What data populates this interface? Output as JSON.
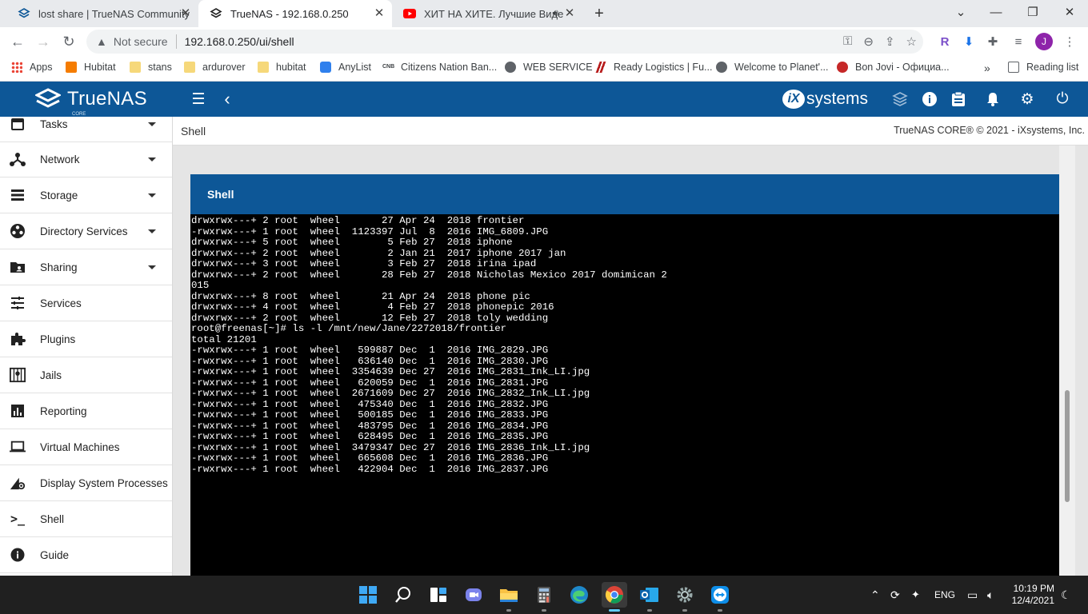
{
  "browser": {
    "tabs": [
      {
        "title": "lost share | TrueNAS Community"
      },
      {
        "title": "TrueNAS - 192.168.0.250"
      },
      {
        "title": "ХИТ НА ХИТЕ. Лучшие Виде"
      }
    ],
    "address": {
      "security": "Not secure",
      "url": "192.168.0.250/ui/shell"
    },
    "profile_initial": "J",
    "bookmarks": [
      "Apps",
      "Hubitat",
      "stans",
      "ardurover",
      "hubitat",
      "AnyList",
      "Citizens Nation Ban...",
      "WEB SERVICE",
      "Ready Logistics | Fu...",
      "Welcome to Planet'...",
      "Bon Jovi - Официа..."
    ],
    "bookmarks_overflow": "»",
    "reading_list": "Reading list"
  },
  "app": {
    "logo_name": "TrueNAS",
    "logo_sub": "CORE",
    "vendor": "systems",
    "vendor_mark": "iX"
  },
  "sidebar": {
    "items": [
      {
        "label": "Tasks",
        "icon": "calendar-icon",
        "dropdown": true
      },
      {
        "label": "Network",
        "icon": "network-icon",
        "dropdown": true
      },
      {
        "label": "Storage",
        "icon": "storage-icon",
        "dropdown": true
      },
      {
        "label": "Directory Services",
        "icon": "directory-icon",
        "dropdown": true
      },
      {
        "label": "Sharing",
        "icon": "folder-share-icon",
        "dropdown": true
      },
      {
        "label": "Services",
        "icon": "tune-icon",
        "dropdown": false
      },
      {
        "label": "Plugins",
        "icon": "puzzle-icon",
        "dropdown": false
      },
      {
        "label": "Jails",
        "icon": "jail-icon",
        "dropdown": false
      },
      {
        "label": "Reporting",
        "icon": "chart-icon",
        "dropdown": false
      },
      {
        "label": "Virtual Machines",
        "icon": "laptop-icon",
        "dropdown": false
      },
      {
        "label": "Display System Processes",
        "icon": "processes-icon",
        "dropdown": false
      },
      {
        "label": "Shell",
        "icon": "terminal-icon",
        "dropdown": false
      },
      {
        "label": "Guide",
        "icon": "info-icon",
        "dropdown": false
      }
    ]
  },
  "page": {
    "title": "Shell",
    "copyright": "TrueNAS CORE® © 2021 - iXsystems, Inc.",
    "card_title": "Shell"
  },
  "terminal": {
    "lines": [
      "drwxrwx---+ 2 root  wheel       27 Apr 24  2018 frontier",
      "-rwxrwx---+ 1 root  wheel  1123397 Jul  8  2016 IMG_6809.JPG",
      "drwxrwx---+ 5 root  wheel        5 Feb 27  2018 iphone",
      "drwxrwx---+ 2 root  wheel        2 Jan 21  2017 iphone 2017 jan",
      "drwxrwx---+ 3 root  wheel        3 Feb 27  2018 irina ipad",
      "drwxrwx---+ 2 root  wheel       28 Feb 27  2018 Nicholas Mexico 2017 domimican 2",
      "015",
      "drwxrwx---+ 8 root  wheel       21 Apr 24  2018 phone pic",
      "drwxrwx---+ 4 root  wheel        4 Feb 27  2018 phonepic 2016",
      "drwxrwx---+ 2 root  wheel       12 Feb 27  2018 toly wedding",
      "root@freenas[~]# ls -l /mnt/new/Jane/2272018/frontier",
      "total 21201",
      "-rwxrwx---+ 1 root  wheel   599887 Dec  1  2016 IMG_2829.JPG",
      "-rwxrwx---+ 1 root  wheel   636140 Dec  1  2016 IMG_2830.JPG",
      "-rwxrwx---+ 1 root  wheel  3354639 Dec 27  2016 IMG_2831_Ink_LI.jpg",
      "-rwxrwx---+ 1 root  wheel   620059 Dec  1  2016 IMG_2831.JPG",
      "-rwxrwx---+ 1 root  wheel  2671609 Dec 27  2016 IMG_2832_Ink_LI.jpg",
      "-rwxrwx---+ 1 root  wheel   475340 Dec  1  2016 IMG_2832.JPG",
      "-rwxrwx---+ 1 root  wheel   500185 Dec  1  2016 IMG_2833.JPG",
      "-rwxrwx---+ 1 root  wheel   483795 Dec  1  2016 IMG_2834.JPG",
      "-rwxrwx---+ 1 root  wheel   628495 Dec  1  2016 IMG_2835.JPG",
      "-rwxrwx---+ 1 root  wheel  3479347 Dec 27  2016 IMG_2836_Ink_LI.jpg",
      "-rwxrwx---+ 1 root  wheel   665608 Dec  1  2016 IMG_2836.JPG",
      "-rwxrwx---+ 1 root  wheel   422904 Dec  1  2016 IMG_2837.JPG"
    ]
  },
  "taskbar": {
    "language": "ENG",
    "time": "10:19 PM",
    "date": "12/4/2021"
  },
  "colors": {
    "brand": "#0d5797",
    "terminal_bg": "#000000",
    "taskbar": "#202020"
  }
}
